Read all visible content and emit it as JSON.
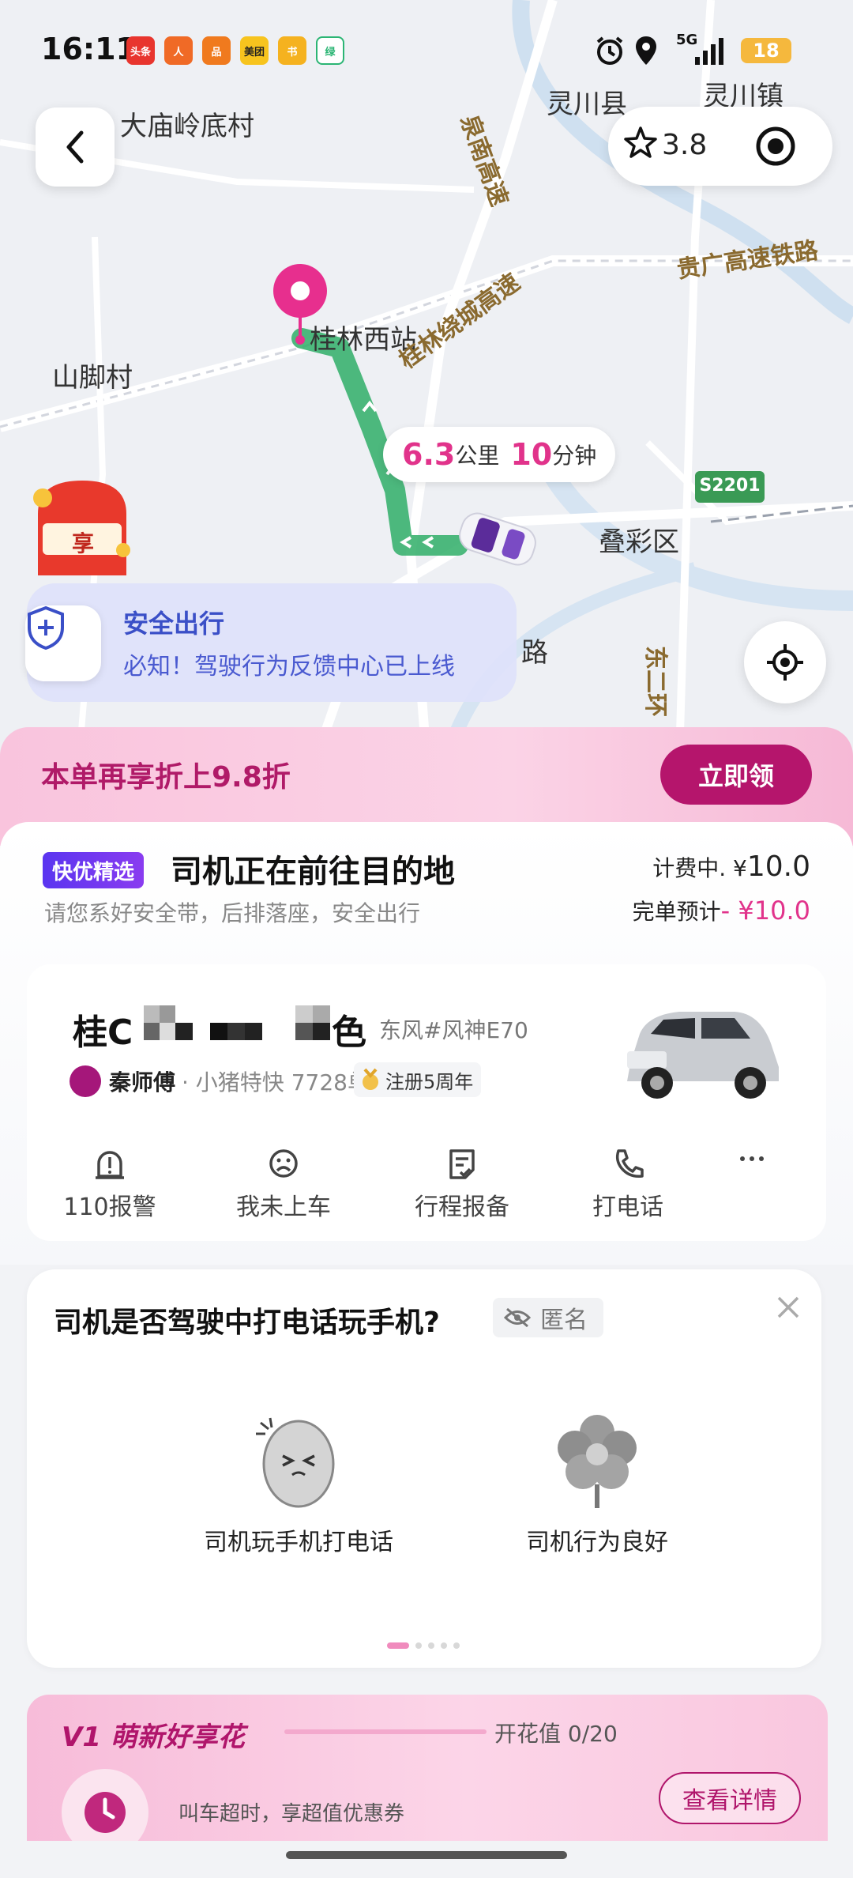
{
  "status_bar": {
    "time": "16:11",
    "app_icons": [
      "头条",
      "人",
      "品",
      "美团",
      "书",
      "绿"
    ],
    "network": "5G",
    "battery": "18"
  },
  "map": {
    "labels": {
      "village_1": "大庙岭底村",
      "county": "灵川县",
      "town": "灵川镇",
      "village_2": "山脚村",
      "station": "桂林西站",
      "district": "叠彩区",
      "road_partial": "路"
    },
    "road_labels": {
      "expressway_1": "泉南高速",
      "railway": "贵广高速铁路",
      "ring_expressway": "桂林绕城高速",
      "east_ring": "东二环"
    },
    "highway_shield": "S2201",
    "rating": "3.8",
    "distance_value": "6.3",
    "distance_unit": "公里",
    "time_value": "10",
    "time_unit": "分钟",
    "share_badge": "享",
    "safety": {
      "title": "安全出行",
      "subtitle": "必知！驾驶行为反馈中心已上线"
    }
  },
  "promo": {
    "text": "本单再享折上9.8折",
    "button": "立即领"
  },
  "trip": {
    "tag": "快优精选",
    "status": "司机正在前往目的地",
    "tip": "请您系好安全带，后排落座，安全出行",
    "fare_label": "计费中.",
    "fare_currency": "¥",
    "fare_value": "10.0",
    "estimate_label": "完单预计",
    "estimate_value": "- ¥10.0",
    "plate_prefix": "桂C",
    "plate_suffix": "色",
    "car_model": "东风#风神E70",
    "driver_name": "秦师傅",
    "driver_meta": "· 小猪特快  7728单",
    "driver_badge": "注册5周年",
    "actions": [
      {
        "label": "110报警",
        "icon": "alert-icon"
      },
      {
        "label": "我未上车",
        "icon": "sad-face-icon"
      },
      {
        "label": "行程报备",
        "icon": "report-icon"
      },
      {
        "label": "打电话",
        "icon": "phone-icon"
      }
    ]
  },
  "feedback": {
    "question": "司机是否驾驶中打电话玩手机?",
    "anonymous": "匿名",
    "options": [
      "司机玩手机打电话",
      "司机行为良好"
    ]
  },
  "member": {
    "title": "V1 萌新好享花",
    "progress_label": "开花值 0/20",
    "progress": 0,
    "desc": "叫车超时，享超值优惠券",
    "button": "查看详情"
  },
  "colors": {
    "brand_pink": "#e1338b",
    "promo_button": "#b5156c",
    "route": "#3dbb76",
    "safety_blue": "#3a4fc7"
  }
}
